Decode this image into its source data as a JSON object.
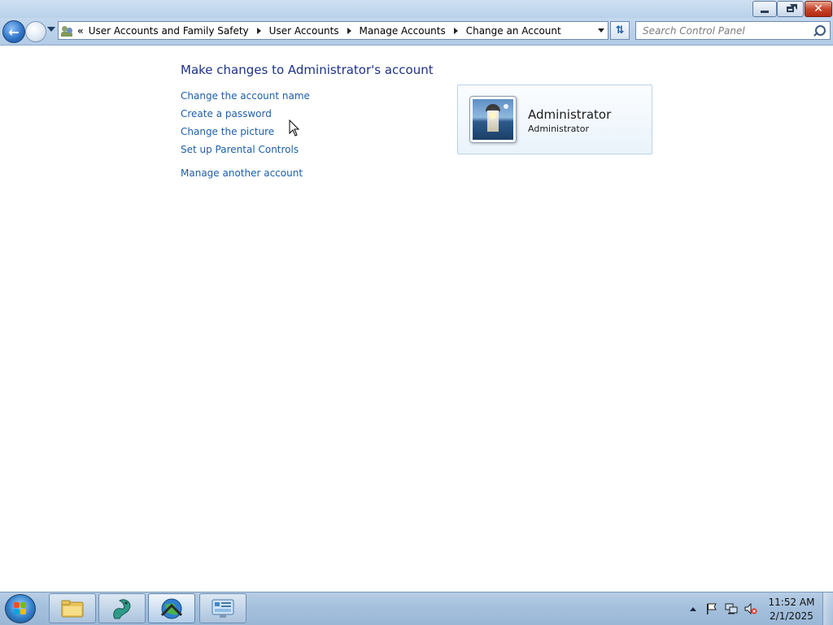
{
  "window": {
    "minimize_label": "",
    "maximize_label": "",
    "close_label": "✕"
  },
  "nav": {
    "chevrons": "«",
    "breadcrumbs": [
      {
        "label": "User Accounts and Family Safety"
      },
      {
        "label": "User Accounts"
      },
      {
        "label": "Manage Accounts"
      },
      {
        "label": "Change an Account"
      }
    ],
    "refresh_icon": "refresh-icon",
    "search_placeholder": "Search Control Panel"
  },
  "main": {
    "title": "Make changes to Administrator's account",
    "tasks": [
      {
        "label": "Change the account name"
      },
      {
        "label": "Create a password"
      },
      {
        "label": "Change the picture"
      },
      {
        "label": "Set up Parental Controls"
      }
    ],
    "manage_other": "Manage another account"
  },
  "account": {
    "name": "Administrator",
    "type": "Administrator",
    "picture": "lighthouse-avatar"
  },
  "taskbar": {
    "items": [
      {
        "name": "windows-explorer",
        "icon": "folder-icon"
      },
      {
        "name": "dragon-app",
        "icon": "dragon-icon"
      },
      {
        "name": "globe-app",
        "icon": "globe-icon"
      },
      {
        "name": "control-panel",
        "icon": "control-panel-icon"
      }
    ],
    "clock_time": "11:52 AM",
    "clock_date": "2/1/2025"
  },
  "colors": {
    "link": "#1e5ea8",
    "title": "#1e3287",
    "card_border": "#b9d4ec"
  }
}
